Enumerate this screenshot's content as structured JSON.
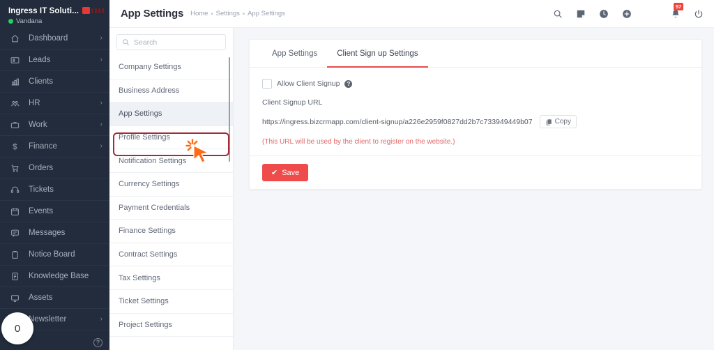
{
  "sidebar": {
    "brand_title": "Ingress IT Soluti...",
    "username": "Vandana",
    "items": [
      {
        "label": "Dashboard",
        "icon": "home-icon",
        "chevron": true
      },
      {
        "label": "Leads",
        "icon": "id-card-icon",
        "chevron": true
      },
      {
        "label": "Clients",
        "icon": "bar-chart-icon",
        "chevron": false
      },
      {
        "label": "HR",
        "icon": "people-icon",
        "chevron": true
      },
      {
        "label": "Work",
        "icon": "briefcase-icon",
        "chevron": true
      },
      {
        "label": "Finance",
        "icon": "dollar-icon",
        "chevron": true
      },
      {
        "label": "Orders",
        "icon": "cart-icon",
        "chevron": false
      },
      {
        "label": "Tickets",
        "icon": "headset-icon",
        "chevron": false
      },
      {
        "label": "Events",
        "icon": "calendar-icon",
        "chevron": false
      },
      {
        "label": "Messages",
        "icon": "chat-icon",
        "chevron": false
      },
      {
        "label": "Notice Board",
        "icon": "clipboard-icon",
        "chevron": false
      },
      {
        "label": "Knowledge Base",
        "icon": "book-icon",
        "chevron": false
      },
      {
        "label": "Assets",
        "icon": "monitor-icon",
        "chevron": false
      },
      {
        "label": "Newsletter",
        "icon": "envelope-icon",
        "chevron": true
      }
    ],
    "help_glyph": "?",
    "chat_count": "0"
  },
  "topbar": {
    "title": "App Settings",
    "breadcrumb": [
      {
        "label": "Home"
      },
      {
        "label": "Settings"
      },
      {
        "label": "App Settings"
      }
    ],
    "separator": "•",
    "icons": [
      "search-icon",
      "note-icon",
      "clock-icon",
      "plus-circle-icon"
    ],
    "notification_badge": "57",
    "power_icon": "power-icon"
  },
  "settings_panel": {
    "search_placeholder": "Search",
    "search_value": "",
    "items": [
      "Company Settings",
      "Business Address",
      "App Settings",
      "Profile Settings",
      "Notification Settings",
      "Currency Settings",
      "Payment Credentials",
      "Finance Settings",
      "Contract Settings",
      "Tax Settings",
      "Ticket Settings",
      "Project Settings"
    ],
    "active_index": 2
  },
  "card": {
    "tabs": [
      {
        "label": "App Settings",
        "active": false
      },
      {
        "label": "Client Sign up Settings",
        "active": true
      }
    ],
    "allow_signup_label": "Allow Client Signup",
    "allow_signup_checked": false,
    "help_glyph": "?",
    "url_field_label": "Client Signup URL",
    "url_value": "https://ingress.bizcrmapp.com/client-signup/a226e2959f0827dd2b7c733949449b07",
    "copy_label": "Copy",
    "hint": "(This URL will be used by the client to register on the website.)",
    "save_label": "Save",
    "save_check_glyph": "✔"
  },
  "colors": {
    "sidebar_bg": "#222c3c",
    "accent_red": "#ef4b4b",
    "tab_underline": "#e84a4a",
    "highlight_ring": "#a6293a",
    "cursor_orange": "#ff6a13",
    "online_green": "#23d160",
    "badge_red": "#f0453a"
  }
}
